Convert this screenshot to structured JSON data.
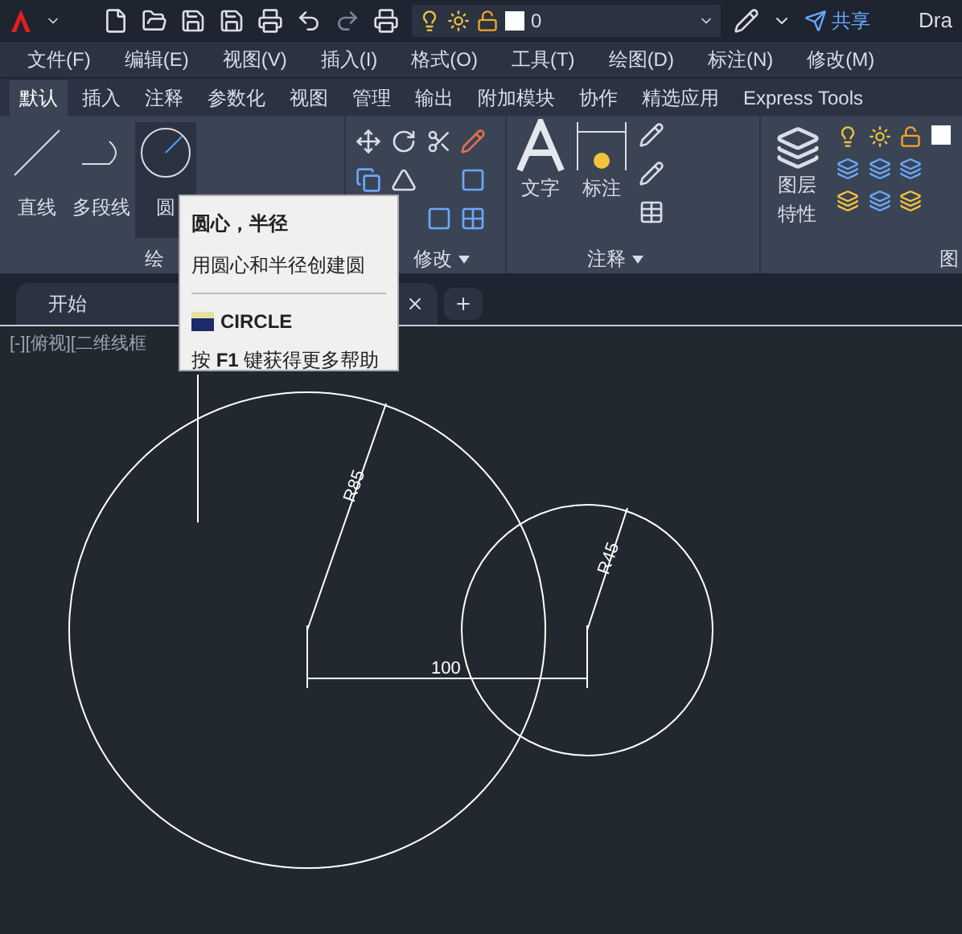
{
  "quick_access": {
    "layer_value": "0",
    "share": "共享",
    "title": "Dra"
  },
  "menu": [
    "文件(F)",
    "编辑(E)",
    "视图(V)",
    "插入(I)",
    "格式(O)",
    "工具(T)",
    "绘图(D)",
    "标注(N)",
    "修改(M)"
  ],
  "tabs": [
    {
      "label": "默认",
      "selected": true
    },
    {
      "label": "插入",
      "selected": false
    },
    {
      "label": "注释",
      "selected": false
    },
    {
      "label": "参数化",
      "selected": false
    },
    {
      "label": "视图",
      "selected": false
    },
    {
      "label": "管理",
      "selected": false
    },
    {
      "label": "输出",
      "selected": false
    },
    {
      "label": "附加模块",
      "selected": false
    },
    {
      "label": "协作",
      "selected": false
    },
    {
      "label": "精选应用",
      "selected": false
    },
    {
      "label": "Express Tools",
      "selected": false
    }
  ],
  "ribbon": {
    "draw_tools": [
      {
        "label": "直线",
        "selected": false
      },
      {
        "label": "多段线",
        "selected": false
      },
      {
        "label": "圆",
        "selected": true
      }
    ],
    "draw_panel": "绘",
    "modify_panel": "修改",
    "text_tool": "文字",
    "dim_tool": "标注",
    "annotate_panel": "注释",
    "layer_tool": "图层特性",
    "layer_panel": "图"
  },
  "tooltip": {
    "title": "圆心，半径",
    "description": "用圆心和半径创建圆",
    "command": "CIRCLE",
    "help": "按 **F1** 键获得更多帮助"
  },
  "file_tabs": [
    {
      "label": "开始",
      "selected": false
    }
  ],
  "viewport_label": "[-][俯视][二维线框",
  "drawing": {
    "big_radius": "R85",
    "small_radius": "R45",
    "distance": "100"
  }
}
